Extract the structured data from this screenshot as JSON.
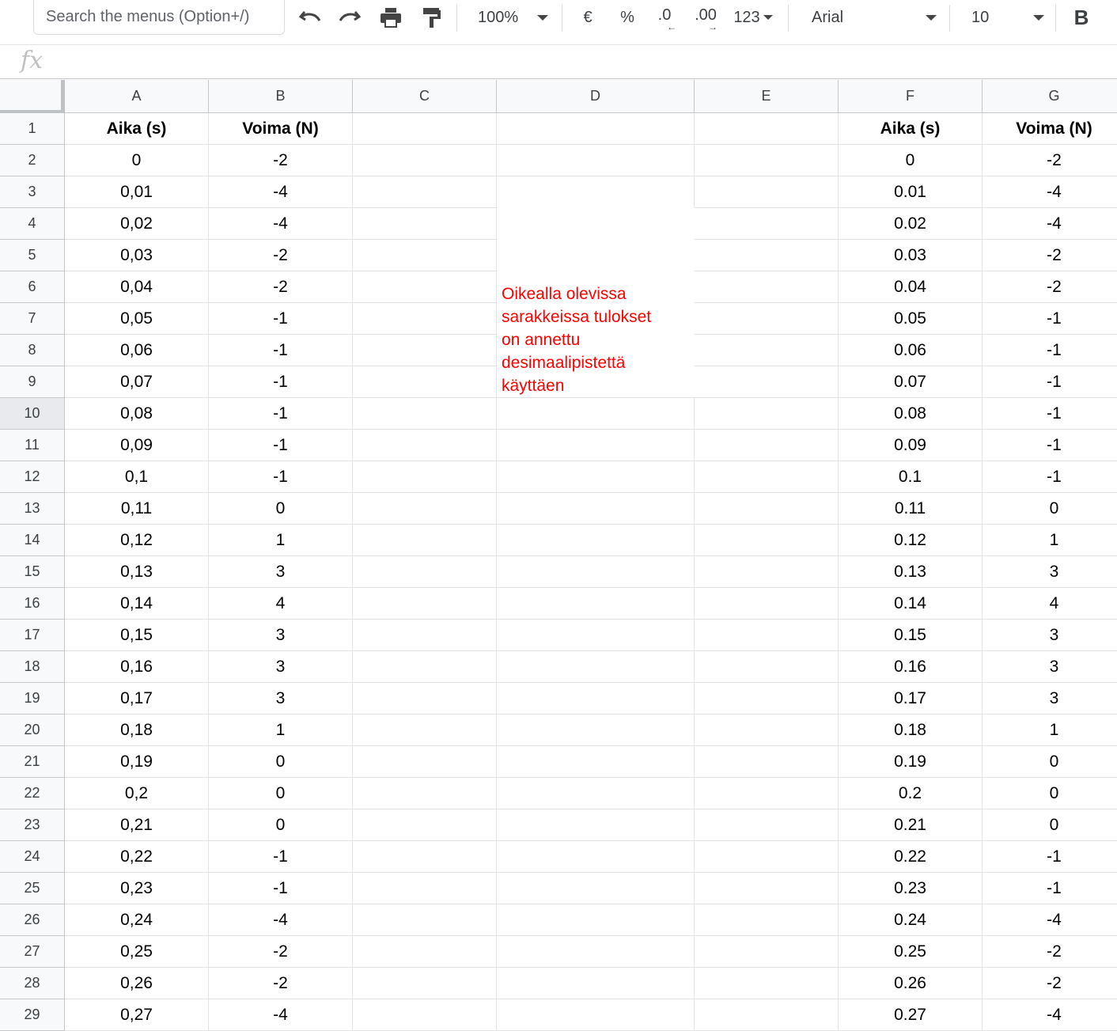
{
  "toolbar": {
    "search_placeholder": "Search the menus (Option+/)",
    "zoom": "100%",
    "currency": "€",
    "percent": "%",
    "decrease_decimal": ".0",
    "increase_decimal": ".00",
    "more_formats": "123",
    "font": "Arial",
    "font_size": "10",
    "bold": "B"
  },
  "formula_bar": {
    "icon": "fx"
  },
  "columns": [
    "A",
    "B",
    "C",
    "D",
    "E",
    "F",
    "G"
  ],
  "selected_row": 10,
  "headers": {
    "aika": "Aika (s)",
    "voima": "Voima (N)"
  },
  "note": [
    "Oikealla olevissa",
    "sarakkeissa tulokset",
    "on annettu",
    "desimaalipistettä",
    "käyttäen"
  ],
  "rows": [
    {
      "n": "1",
      "a": "Aika (s)",
      "b": "Voima (N)",
      "f": "Aika (s)",
      "g": "Voima (N)"
    },
    {
      "n": "2",
      "a": "0",
      "b": "-2",
      "f": "0",
      "g": "-2"
    },
    {
      "n": "3",
      "a": "0,01",
      "b": "-4",
      "f": "0.01",
      "g": "-4"
    },
    {
      "n": "4",
      "a": "0,02",
      "b": "-4",
      "f": "0.02",
      "g": "-4"
    },
    {
      "n": "5",
      "a": "0,03",
      "b": "-2",
      "f": "0.03",
      "g": "-2"
    },
    {
      "n": "6",
      "a": "0,04",
      "b": "-2",
      "f": "0.04",
      "g": "-2"
    },
    {
      "n": "7",
      "a": "0,05",
      "b": "-1",
      "f": "0.05",
      "g": "-1"
    },
    {
      "n": "8",
      "a": "0,06",
      "b": "-1",
      "f": "0.06",
      "g": "-1"
    },
    {
      "n": "9",
      "a": "0,07",
      "b": "-1",
      "f": "0.07",
      "g": "-1"
    },
    {
      "n": "10",
      "a": "0,08",
      "b": "-1",
      "f": "0.08",
      "g": "-1"
    },
    {
      "n": "11",
      "a": "0,09",
      "b": "-1",
      "f": "0.09",
      "g": "-1"
    },
    {
      "n": "12",
      "a": "0,1",
      "b": "-1",
      "f": "0.1",
      "g": "-1"
    },
    {
      "n": "13",
      "a": "0,11",
      "b": "0",
      "f": "0.11",
      "g": "0"
    },
    {
      "n": "14",
      "a": "0,12",
      "b": "1",
      "f": "0.12",
      "g": "1"
    },
    {
      "n": "15",
      "a": "0,13",
      "b": "3",
      "f": "0.13",
      "g": "3"
    },
    {
      "n": "16",
      "a": "0,14",
      "b": "4",
      "f": "0.14",
      "g": "4"
    },
    {
      "n": "17",
      "a": "0,15",
      "b": "3",
      "f": "0.15",
      "g": "3"
    },
    {
      "n": "18",
      "a": "0,16",
      "b": "3",
      "f": "0.16",
      "g": "3"
    },
    {
      "n": "19",
      "a": "0,17",
      "b": "3",
      "f": "0.17",
      "g": "3"
    },
    {
      "n": "20",
      "a": "0,18",
      "b": "1",
      "f": "0.18",
      "g": "1"
    },
    {
      "n": "21",
      "a": "0,19",
      "b": "0",
      "f": "0.19",
      "g": "0"
    },
    {
      "n": "22",
      "a": "0,2",
      "b": "0",
      "f": "0.2",
      "g": "0"
    },
    {
      "n": "23",
      "a": "0,21",
      "b": "0",
      "f": "0.21",
      "g": "0"
    },
    {
      "n": "24",
      "a": "0,22",
      "b": "-1",
      "f": "0.22",
      "g": "-1"
    },
    {
      "n": "25",
      "a": "0,23",
      "b": "-1",
      "f": "0.23",
      "g": "-1"
    },
    {
      "n": "26",
      "a": "0,24",
      "b": "-4",
      "f": "0.24",
      "g": "-4"
    },
    {
      "n": "27",
      "a": "0,25",
      "b": "-2",
      "f": "0.25",
      "g": "-2"
    },
    {
      "n": "28",
      "a": "0,26",
      "b": "-2",
      "f": "0.26",
      "g": "-2"
    },
    {
      "n": "29",
      "a": "0,27",
      "b": "-4",
      "f": "0.27",
      "g": "-4"
    }
  ]
}
